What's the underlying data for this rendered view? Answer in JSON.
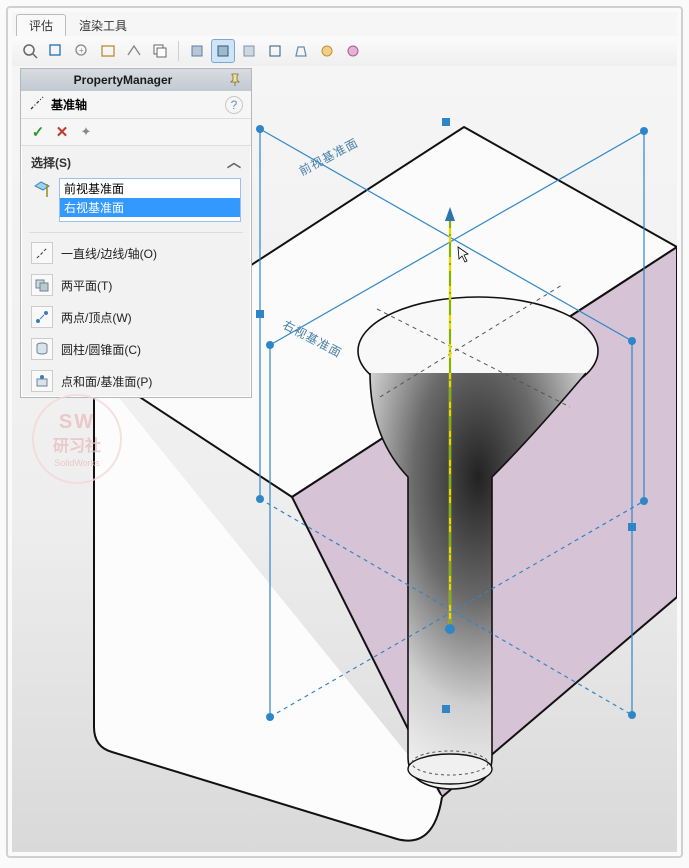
{
  "tabs": {
    "eval": "评估",
    "render": "渲染工具"
  },
  "panel": {
    "title": "PropertyManager",
    "feature": "基准轴",
    "select_header": "选择(S)",
    "items": [
      "前视基准面",
      "右视基准面"
    ],
    "options": {
      "line_edge": "一直线/边线/轴(O)",
      "two_planes": "两平面(T)",
      "two_points": "两点/顶点(W)",
      "cylinder": "圆柱/圆锥面(C)",
      "point_face": "点和面/基准面(P)"
    }
  },
  "plane_labels": {
    "front": "前视基准面",
    "right": "右视基准面"
  },
  "watermark": {
    "l1": "SW",
    "l2": "研习社",
    "l3": "SolidWorks"
  }
}
